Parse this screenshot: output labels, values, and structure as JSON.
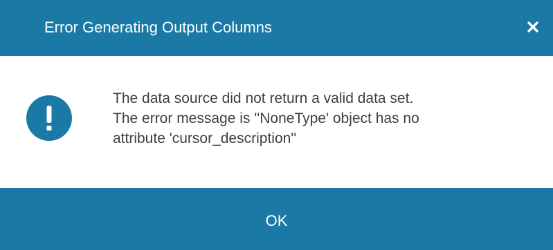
{
  "dialog": {
    "title": "Error Generating Output Columns",
    "close_icon": "close-icon",
    "icon": "exclamation-circle-icon",
    "message_lines": [
      "The data source did not return a valid data set.",
      "The error message is ''NoneType' object has no",
      "attribute 'cursor_description''"
    ],
    "ok_label": "OK"
  },
  "colors": {
    "accent": "#1a7aa5",
    "text": "#3f3f3f",
    "on_accent": "#ffffff"
  }
}
